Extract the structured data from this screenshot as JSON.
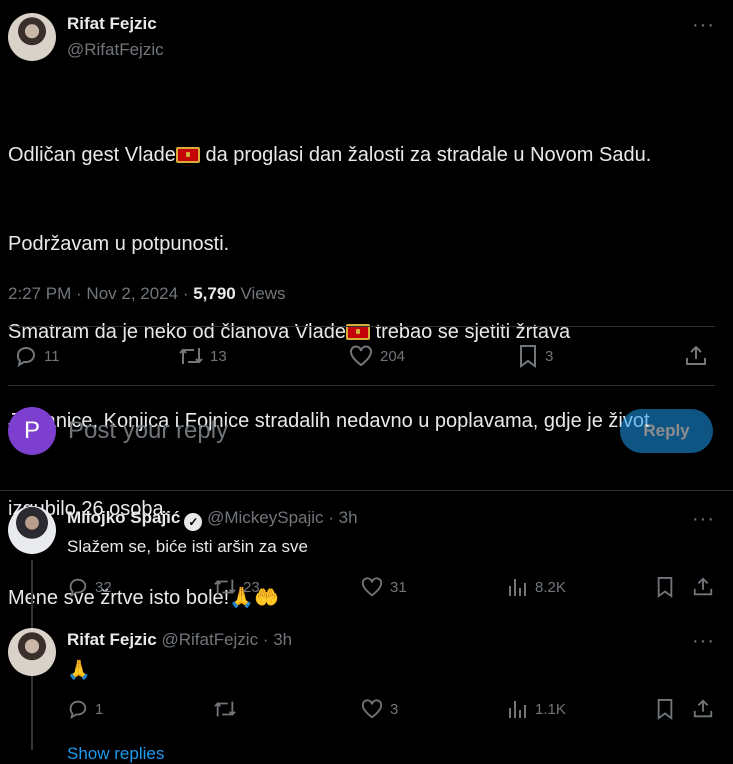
{
  "main_tweet": {
    "author_name": "Rifat Fejzic",
    "author_handle": "@RifatFejzic",
    "line1_a": "Odličan gest Vlade",
    "line1_b": " da proglasi dan žalosti za stradale u Novom Sadu.",
    "line2": "Podržavam u potpunosti.",
    "line3_a": "Smatram da je neko od članova Vlade",
    "line3_b": " trebao se sjetiti žrtava",
    "line4": "Jablanice, Konjica i Fojnice stradalih nedavno u poplavama, gdje je život",
    "line5": "izgubilo 26 osoba.",
    "line6": "Mene sve žrtve isto bole!",
    "emoji_end": "🙏🤲",
    "time": "2:27 PM · Nov 2, 2024 · ",
    "views_count": "5,790",
    "views_label": " Views",
    "stats": {
      "replies": "11",
      "reposts": "13",
      "likes": "204",
      "bookmarks": "3"
    }
  },
  "reply_box": {
    "avatar_letter": "P",
    "placeholder": "Post your reply",
    "button_label": "Reply"
  },
  "replies": [
    {
      "name": "Milojko Spajić",
      "handle": "@MickeySpajic",
      "time": " · 3h",
      "text": "Slažem se, biće isti aršin za sve",
      "stats": {
        "replies": "32",
        "reposts": "23",
        "likes": "31",
        "views": "8.2K"
      }
    },
    {
      "name": "Rifat Fejzic",
      "handle": "@RifatFejzic",
      "time": " · 3h",
      "text": "🙏",
      "stats": {
        "replies": "1",
        "reposts": "",
        "likes": "3",
        "views": "1.1K"
      }
    }
  ],
  "show_replies": "Show replies",
  "colors": {
    "accent": "#1d9bf0",
    "muted": "#71767b",
    "text": "#e7e9ea",
    "divider": "#2f3336"
  }
}
